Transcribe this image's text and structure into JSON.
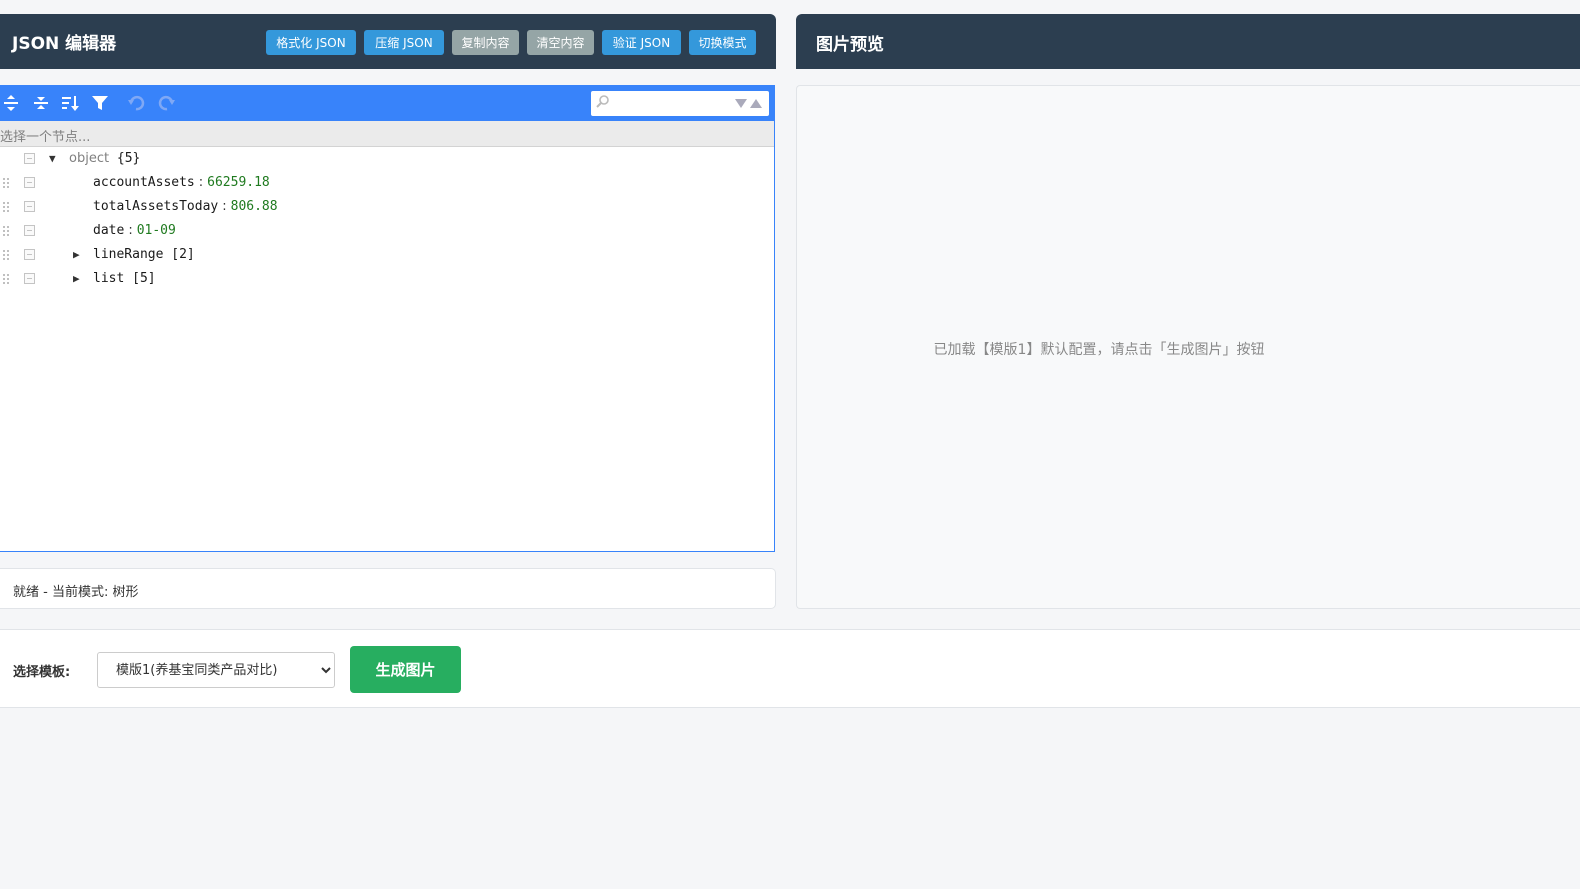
{
  "editor": {
    "title": "JSON 编辑器",
    "buttons": {
      "format": "格式化 JSON",
      "compress": "压缩 JSON",
      "copy": "复制内容",
      "clear": "清空内容",
      "validate": "验证 JSON",
      "switch_mode": "切换模式"
    },
    "toolbar_icons": [
      "expand-all-icon",
      "collapse-all-icon",
      "sort-icon",
      "filter-icon",
      "undo-icon",
      "redo-icon"
    ],
    "search_placeholder": "",
    "nav_placeholder": "选择一个节点...",
    "tree": {
      "root_label": "object",
      "root_count": "{5}",
      "nodes": [
        {
          "key": "accountAssets",
          "value": "66259.18"
        },
        {
          "key": "totalAssetsToday",
          "value": "806.88"
        },
        {
          "key": "date",
          "value": "01-09"
        },
        {
          "key": "lineRange",
          "count": "[2]"
        },
        {
          "key": "list",
          "count": "[5]"
        }
      ]
    },
    "status": "就绪 - 当前模式: 树形"
  },
  "preview": {
    "title": "图片预览",
    "message": "已加载【模版1】默认配置，请点击「生成图片」按钮"
  },
  "bottom": {
    "template_label": "选择模板:",
    "template_selected": "模版1(养基宝同类产品对比)",
    "generate_label": "生成图片"
  },
  "colors": {
    "header_bg": "#2c3e50",
    "toolbar_bg": "#3883fa",
    "blue_button": "#3498db",
    "gray_button": "#95a5a6",
    "generate_button": "#27ae60"
  }
}
